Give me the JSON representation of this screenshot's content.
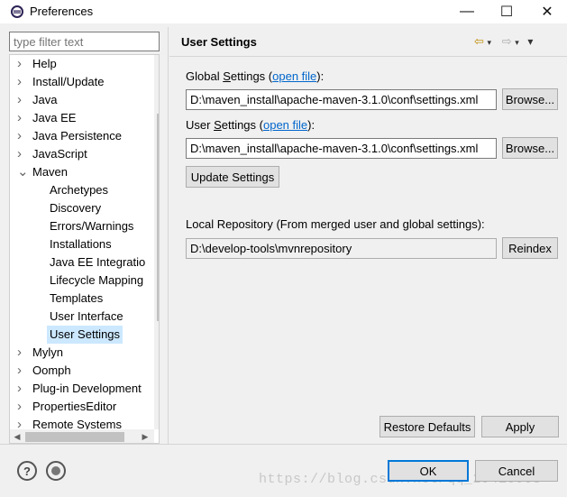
{
  "window": {
    "title": "Preferences",
    "minimize_glyph": "—",
    "maximize_glyph": "☐",
    "close_glyph": "✕"
  },
  "filter": {
    "placeholder": "type filter text"
  },
  "tree": {
    "items": [
      {
        "label": "Help",
        "level": 0,
        "expander": "›"
      },
      {
        "label": "Install/Update",
        "level": 0,
        "expander": "›"
      },
      {
        "label": "Java",
        "level": 0,
        "expander": "›"
      },
      {
        "label": "Java EE",
        "level": 0,
        "expander": "›"
      },
      {
        "label": "Java Persistence",
        "level": 0,
        "expander": "›"
      },
      {
        "label": "JavaScript",
        "level": 0,
        "expander": "›"
      },
      {
        "label": "Maven",
        "level": 0,
        "expander": "⌄"
      },
      {
        "label": "Archetypes",
        "level": 1,
        "expander": ""
      },
      {
        "label": "Discovery",
        "level": 1,
        "expander": ""
      },
      {
        "label": "Errors/Warnings",
        "level": 1,
        "expander": ""
      },
      {
        "label": "Installations",
        "level": 1,
        "expander": ""
      },
      {
        "label": "Java EE Integratio",
        "level": 1,
        "expander": ""
      },
      {
        "label": "Lifecycle Mapping",
        "level": 1,
        "expander": ""
      },
      {
        "label": "Templates",
        "level": 1,
        "expander": ""
      },
      {
        "label": "User Interface",
        "level": 1,
        "expander": ""
      },
      {
        "label": "User Settings",
        "level": 1,
        "expander": "",
        "selected": true
      },
      {
        "label": "Mylyn",
        "level": 0,
        "expander": "›"
      },
      {
        "label": "Oomph",
        "level": 0,
        "expander": "›"
      },
      {
        "label": "Plug-in Development",
        "level": 0,
        "expander": "›"
      },
      {
        "label": "PropertiesEditor",
        "level": 0,
        "expander": "›"
      },
      {
        "label": "Remote Systems",
        "level": 0,
        "expander": "›"
      }
    ]
  },
  "page": {
    "title": "User Settings",
    "back_icon": "⇦",
    "forward_icon": "⇨",
    "menu_icon": "▾"
  },
  "global_settings": {
    "label_pre": "Global ",
    "label_mnemonic": "S",
    "label_post": "ettings (",
    "link": "open file",
    "label_end": "):",
    "value": "D:\\maven_install\\apache-maven-3.1.0\\conf\\settings.xml",
    "browse": "Browse..."
  },
  "user_settings": {
    "label_pre": "User ",
    "label_mnemonic": "S",
    "label_post": "ettings (",
    "link": "open file",
    "label_end": "):",
    "value": "D:\\maven_install\\apache-maven-3.1.0\\conf\\settings.xml",
    "browse": "Browse..."
  },
  "update_button": "Update Settings",
  "local_repo": {
    "label": "Local Repository (From merged user and global settings):",
    "value": "D:\\develop-tools\\mvnrepository",
    "reindex": "Reindex"
  },
  "restore_defaults": "Restore Defaults",
  "apply": "Apply",
  "ok": "OK",
  "cancel": "Cancel",
  "help_icon": "?",
  "watermark": "https://blog.csdn.net/qq_29410905"
}
